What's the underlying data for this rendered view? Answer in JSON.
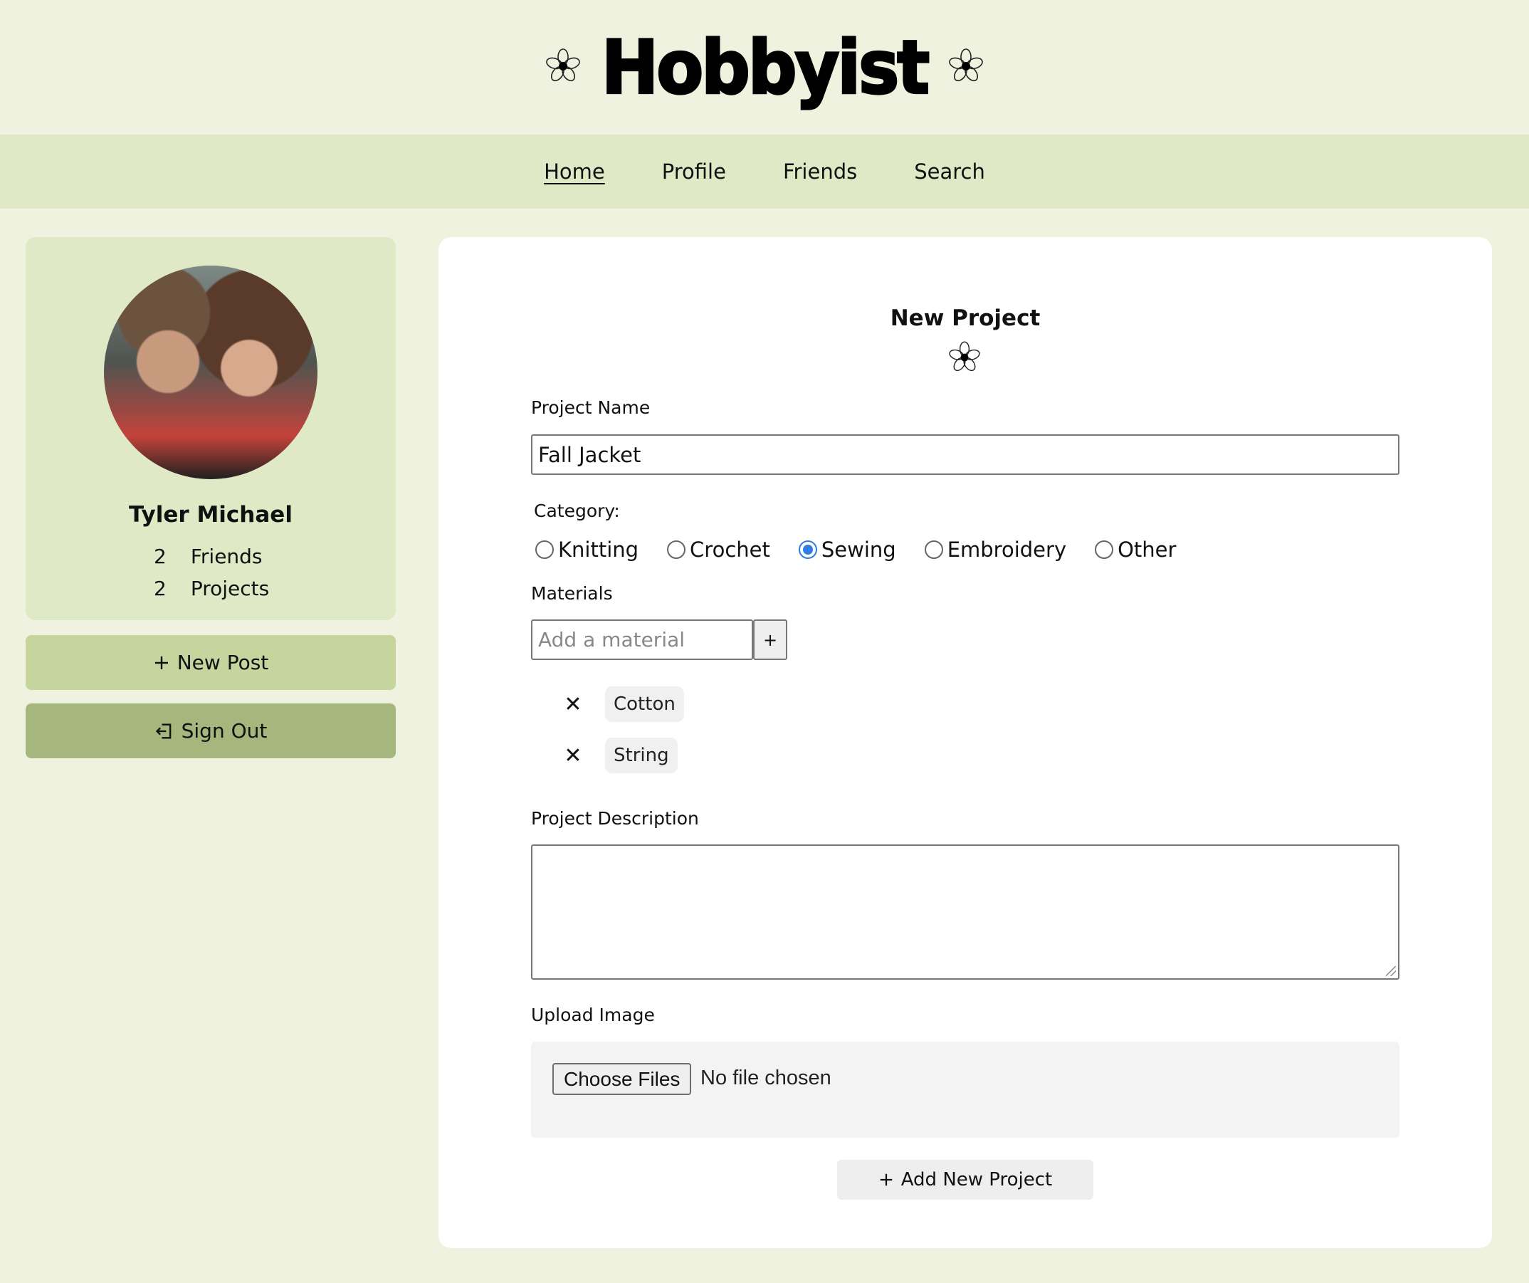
{
  "header": {
    "logo_text": "Hobbyist"
  },
  "nav": {
    "items": [
      {
        "label": "Home",
        "active": true
      },
      {
        "label": "Profile"
      },
      {
        "label": "Friends"
      },
      {
        "label": "Search"
      }
    ]
  },
  "profile": {
    "name": "Tyler Michael",
    "friends_count": "2",
    "friends_label": "Friends",
    "projects_count": "2",
    "projects_label": "Projects"
  },
  "sidebar": {
    "new_post_label": "New Post",
    "sign_out_label": "Sign Out"
  },
  "form": {
    "title": "New Project",
    "project_name_label": "Project Name",
    "project_name_value": "Fall Jacket",
    "category_label": "Category:",
    "categories": [
      "Knitting",
      "Crochet",
      "Sewing",
      "Embroidery",
      "Other"
    ],
    "selected_category": "Sewing",
    "materials_label": "Materials",
    "material_placeholder": "Add a material",
    "add_material_button": "+",
    "materials": [
      "Cotton",
      "String"
    ],
    "description_label": "Project Description",
    "description_value": "",
    "upload_label": "Upload Image",
    "choose_files_label": "Choose Files",
    "file_status": "No file chosen",
    "submit_label": "Add New Project"
  },
  "icons": {
    "flower": "flower-icon",
    "plus": "plus-icon",
    "sign_out": "sign-out-icon",
    "remove": "close-icon"
  },
  "colors": {
    "background": "#eef2df",
    "nav_background": "#e0e9c6",
    "new_post_button": "#c5d59d",
    "sign_out_button": "#a6b77d",
    "radio_checked": "#2f7de1"
  }
}
